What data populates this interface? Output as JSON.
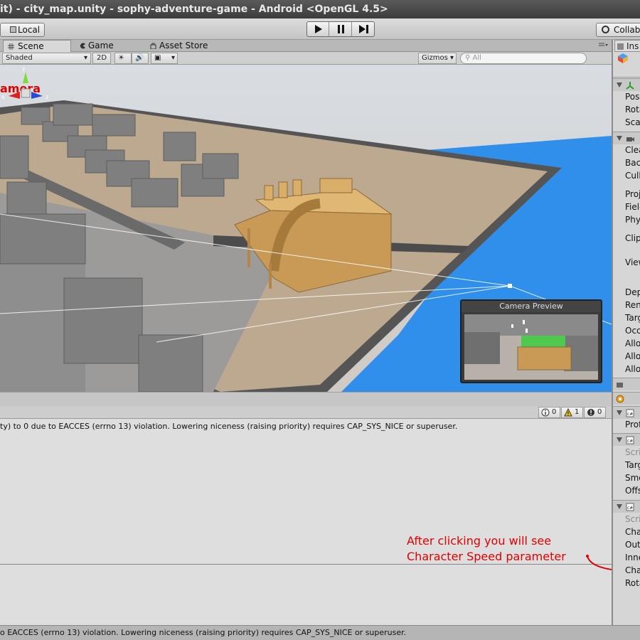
{
  "window": {
    "title": "it) - city_map.unity - sophy-adventure-game - Android <OpenGL 4.5>"
  },
  "toolbar": {
    "local_label": "Local",
    "collab_label": "Collab"
  },
  "tabs": [
    {
      "label": "Scene"
    },
    {
      "label": "Game"
    },
    {
      "label": "Asset Store"
    }
  ],
  "scene_toolbar": {
    "shading_mode": "Shaded",
    "mode_2d": "2D",
    "gizmos_label": "Gizmos",
    "search_placeholder": "All"
  },
  "scene": {
    "overlay_label": "amera",
    "camera_preview_title": "Camera Preview",
    "axis_x": "x",
    "axis_z": "z",
    "axis_y": "y"
  },
  "console": {
    "info_count": "0",
    "warning_count": "1",
    "error_count": "0",
    "message": "ty) to 0 due to EACCES (errno 13) violation. Lowering niceness (raising priority) requires CAP_SYS_NICE or superuser."
  },
  "annotation": {
    "line1": "After clicking you will see",
    "line2": "Character Speed parameter"
  },
  "status_bar": {
    "message": "o EACCES (errno 13) violation. Lowering niceness (raising priority) requires CAP_SYS_NICE or superuser."
  },
  "inspector": {
    "tab_label": "Ins",
    "transform_rows": [
      "Posi",
      "Rota",
      "Scal"
    ],
    "camera_rows": [
      "Clea",
      "Back",
      "Culli",
      "Proj",
      "Field",
      "Phys",
      "Clipp",
      "View",
      "Dept",
      "Rend",
      "Targ",
      "Occl",
      "Allow",
      "Allow",
      "Allow"
    ],
    "profile_row": "Prof",
    "script1_rows": [
      "Scrip",
      "Targ",
      "Smo",
      "Offs"
    ],
    "script2_rows": [
      "Scrip",
      "Char",
      "Oute",
      "Inne",
      "Char",
      "Rota"
    ]
  },
  "colors": {
    "annotation_red": "#e00000",
    "water_blue": "#2f8fea",
    "building_gold": "#c99a55"
  }
}
